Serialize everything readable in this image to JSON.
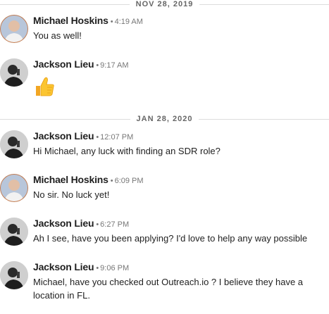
{
  "date_separators": [
    "NOV 28, 2019",
    "JAN 28, 2020"
  ],
  "messages": [
    {
      "name": "Michael Hoskins",
      "time": "4:19 AM",
      "text": "You as well!"
    },
    {
      "name": "Jackson Lieu",
      "time": "9:17 AM",
      "emoji": "thumbs-up-emoji"
    },
    {
      "name": "Jackson Lieu",
      "time": "12:07 PM",
      "text": "Hi Michael, any luck with finding an SDR role?"
    },
    {
      "name": "Michael Hoskins",
      "time": "6:09 PM",
      "text": "No sir. No luck yet!"
    },
    {
      "name": "Jackson Lieu",
      "time": "6:27 PM",
      "text": "Ah I see, have you been applying? I'd love to help any way possible"
    },
    {
      "name": "Jackson Lieu",
      "time": "9:06 PM",
      "text": "Michael, have you checked out Outreach.io ?  I believe they have a location in FL."
    }
  ],
  "separator_dot": "•"
}
